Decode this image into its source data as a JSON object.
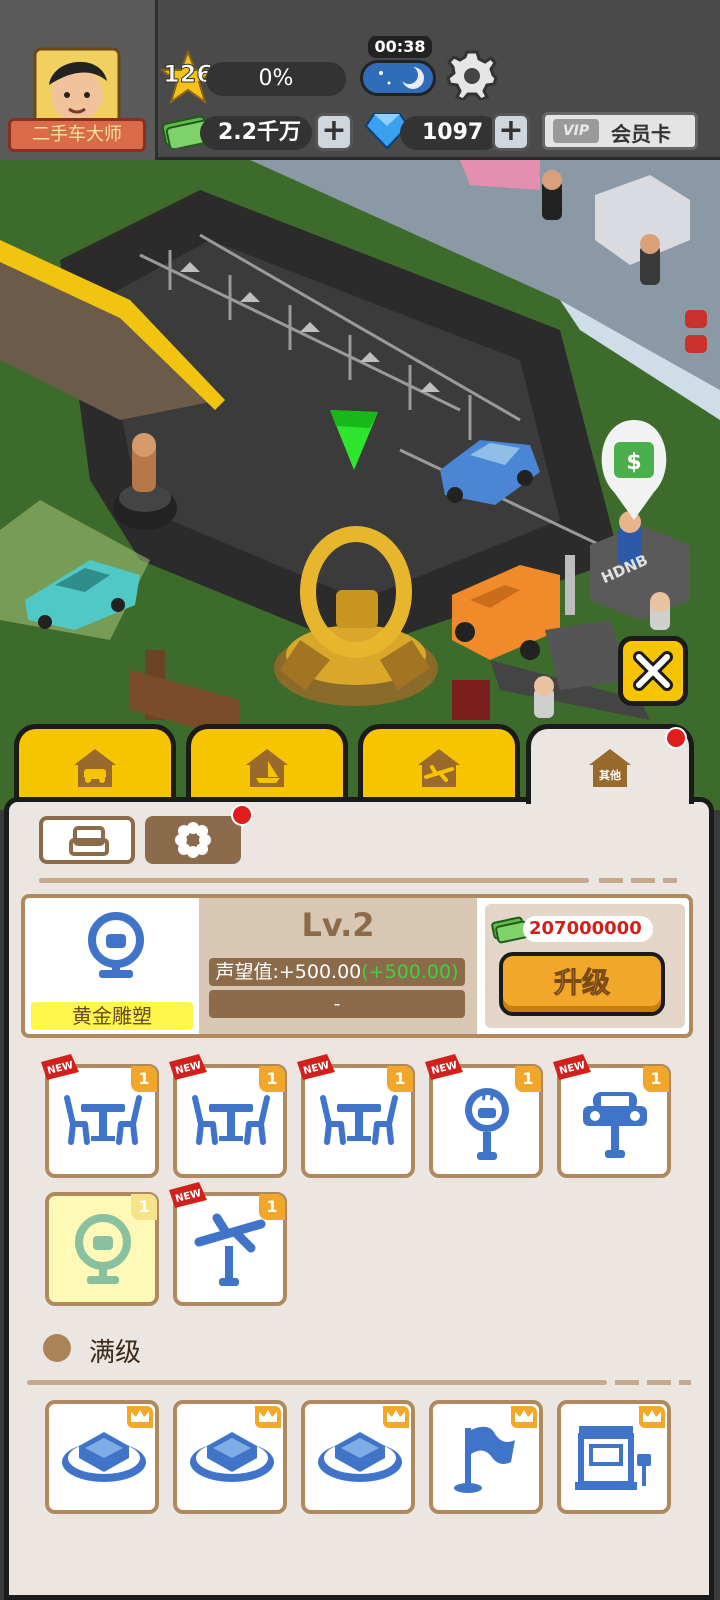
{
  "header": {
    "player_title": "二手车大师",
    "level": "126",
    "progress_text": "0%",
    "progress_fraction": 0,
    "timer": "00:38",
    "cash": "2.2千万",
    "diamonds": "1097",
    "vip_badge": "VIP",
    "vip_label": "会员卡"
  },
  "map": {
    "store_sign": "HDNB"
  },
  "tabs": [
    {
      "icon": "car-house-icon"
    },
    {
      "icon": "boat-house-icon"
    },
    {
      "icon": "plane-house-icon"
    },
    {
      "icon": "other-house-icon",
      "label": "其他",
      "active": true
    }
  ],
  "selected_item": {
    "name": "黄金雕塑",
    "level": "Lv.2",
    "reputation_base": "声望值:+500.00",
    "reputation_bonus": "(+500.00)",
    "secondary_stat": "-",
    "cost": "207000000",
    "upgrade_label": "升级"
  },
  "items": [
    {
      "icon": "table-chairs-icon",
      "count": "1",
      "new_label": "NEW"
    },
    {
      "icon": "table-chairs-icon",
      "count": "1",
      "new_label": "NEW"
    },
    {
      "icon": "table-chairs-icon",
      "count": "1",
      "new_label": "NEW"
    },
    {
      "icon": "coffee-sign-icon",
      "count": "1",
      "new_label": "NEW"
    },
    {
      "icon": "car-sign-icon",
      "count": "1",
      "new_label": "NEW"
    },
    {
      "icon": "steering-wheel-statue-icon",
      "count": "1",
      "selected": true
    },
    {
      "icon": "plane-sign-icon",
      "count": "1",
      "new_label": "NEW"
    }
  ],
  "max_level_section": {
    "title": "满级",
    "items": [
      {
        "icon": "platform-icon"
      },
      {
        "icon": "platform-icon"
      },
      {
        "icon": "platform-icon"
      },
      {
        "icon": "flag-icon"
      },
      {
        "icon": "shop-building-icon"
      }
    ]
  },
  "colors": {
    "tab_yellow": "#f7c400",
    "panel_bg": "#ece6e3",
    "card_border": "#b08a5e",
    "upgrade_orange": "#f0a72a",
    "price_red": "#d0211c",
    "bonus_green": "#3fd13f"
  }
}
